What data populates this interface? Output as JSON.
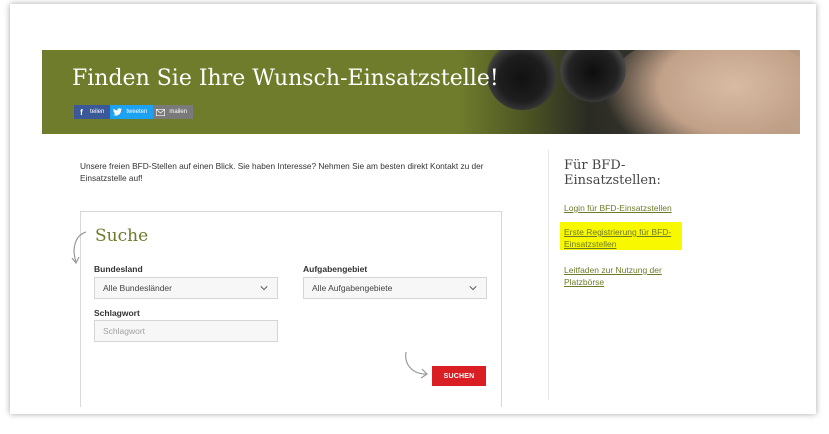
{
  "hero": {
    "title": "Finden Sie Ihre Wunsch-Einsatzstelle!",
    "share": [
      {
        "icon": "facebook-icon",
        "glyph": "f",
        "label": "teilen",
        "color": "#3b5998"
      },
      {
        "icon": "twitter-icon",
        "glyph": "t",
        "label": "tweeten",
        "color": "#1da1f2"
      },
      {
        "icon": "mail-icon",
        "glyph": "✉",
        "label": "mailen",
        "color": "#7a7a7a"
      }
    ]
  },
  "intro": "Unsere freien BFD-Stellen auf einen Blick. Sie haben Interesse? Nehmen Sie am besten direkt Kontakt zu der Einsatzstelle auf!",
  "search": {
    "title": "Suche",
    "bundesland_label": "Bundesland",
    "bundesland_value": "Alle Bundesländer",
    "aufgabengebiet_label": "Aufgabengebiet",
    "aufgabengebiet_value": "Alle Aufgabengebiete",
    "schlagwort_label": "Schlagwort",
    "schlagwort_placeholder": "Schlagwort",
    "button_label": "SUCHEN"
  },
  "sidebar": {
    "title": "Für BFD-Einsatzstellen:",
    "links": [
      {
        "label": "Login für BFD-Einsatzstellen"
      },
      {
        "label": "Erste Registrierung für BFD-Einsatzstellen",
        "highlighted": true
      },
      {
        "label": "Leitfaden zur Nutzung der Platzbörse"
      }
    ]
  },
  "colors": {
    "accent_green": "#6e7a2a",
    "button_red": "#d91e24",
    "highlight": "#f8f800"
  }
}
